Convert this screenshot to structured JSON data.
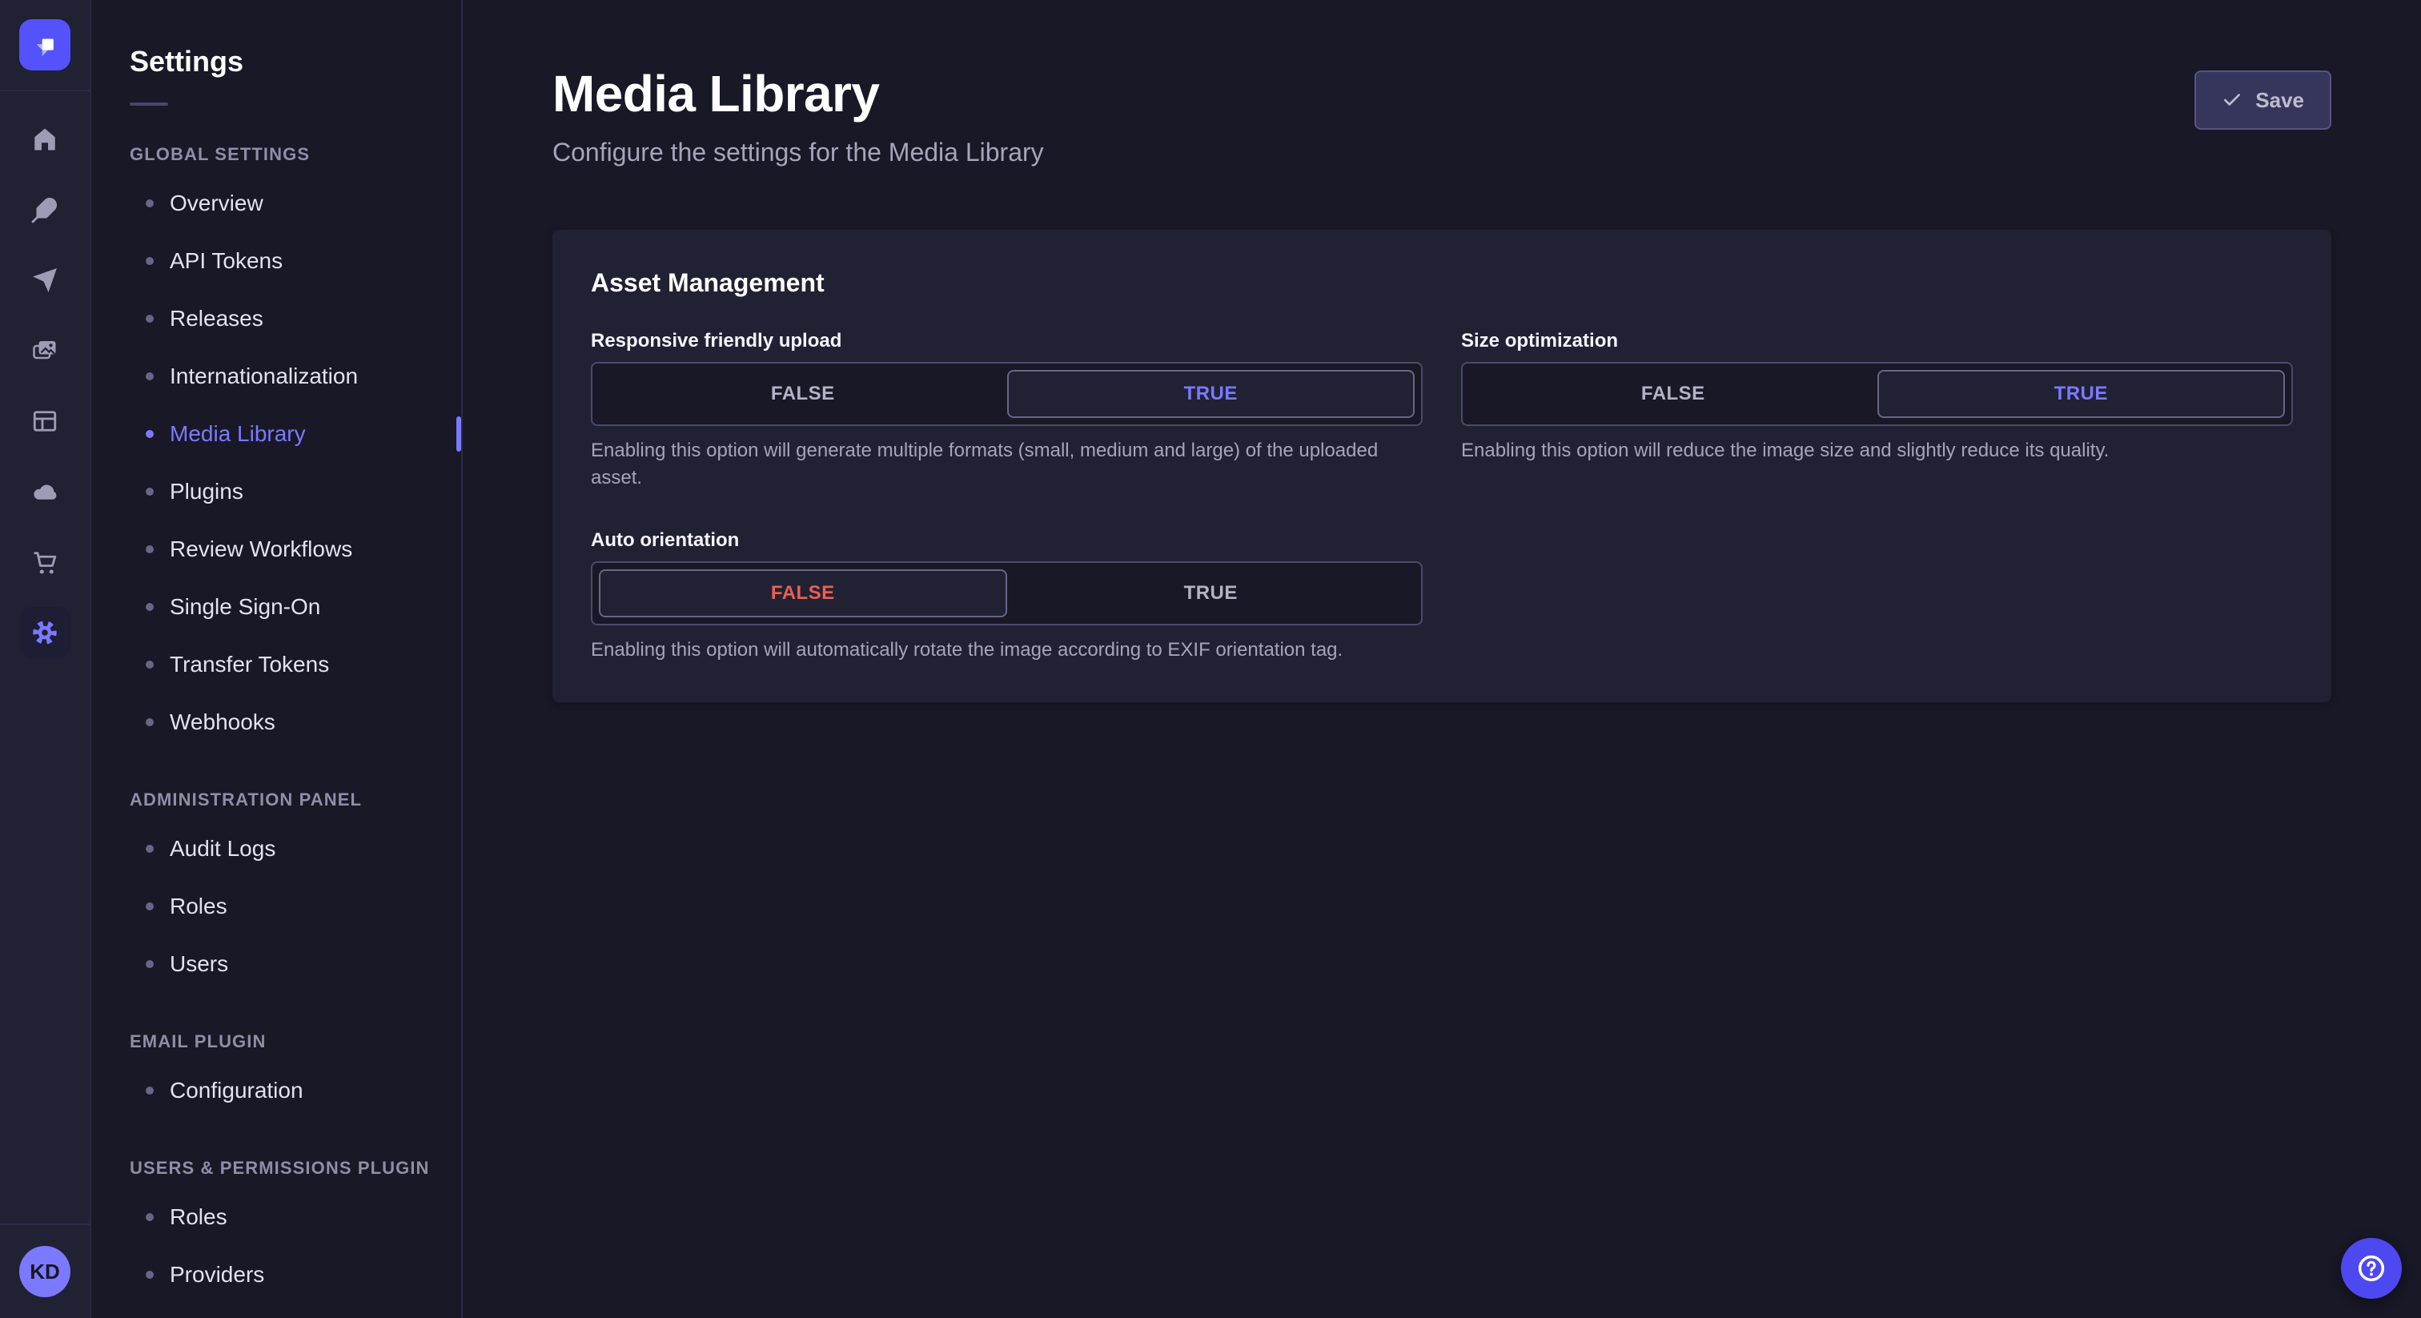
{
  "rail": {
    "avatar_initials": "KD",
    "icons": [
      {
        "name": "home-icon"
      },
      {
        "name": "feather-icon"
      },
      {
        "name": "paper-plane-icon"
      },
      {
        "name": "media-images-icon"
      },
      {
        "name": "layout-icon"
      },
      {
        "name": "cloud-icon"
      },
      {
        "name": "cart-icon"
      },
      {
        "name": "gear-icon",
        "active": true
      }
    ]
  },
  "subnav": {
    "title": "Settings",
    "sections": [
      {
        "label": "GLOBAL SETTINGS",
        "items": [
          {
            "label": "Overview"
          },
          {
            "label": "API Tokens"
          },
          {
            "label": "Releases"
          },
          {
            "label": "Internationalization"
          },
          {
            "label": "Media Library",
            "active": true
          },
          {
            "label": "Plugins"
          },
          {
            "label": "Review Workflows"
          },
          {
            "label": "Single Sign-On"
          },
          {
            "label": "Transfer Tokens"
          },
          {
            "label": "Webhooks"
          }
        ]
      },
      {
        "label": "ADMINISTRATION PANEL",
        "items": [
          {
            "label": "Audit Logs"
          },
          {
            "label": "Roles"
          },
          {
            "label": "Users"
          }
        ]
      },
      {
        "label": "EMAIL PLUGIN",
        "items": [
          {
            "label": "Configuration"
          }
        ]
      },
      {
        "label": "USERS & PERMISSIONS PLUGIN",
        "items": [
          {
            "label": "Roles"
          },
          {
            "label": "Providers"
          }
        ]
      }
    ]
  },
  "page": {
    "title": "Media Library",
    "subtitle": "Configure the settings for the Media Library",
    "save_label": "Save"
  },
  "card": {
    "title": "Asset Management",
    "fields": [
      {
        "label": "Responsive friendly upload",
        "options": [
          "FALSE",
          "TRUE"
        ],
        "value": "TRUE",
        "hint": "Enabling this option will generate multiple formats (small, medium and large) of the uploaded asset."
      },
      {
        "label": "Size optimization",
        "options": [
          "FALSE",
          "TRUE"
        ],
        "value": "TRUE",
        "hint": "Enabling this option will reduce the image size and slightly reduce its quality."
      },
      {
        "label": "Auto orientation",
        "options": [
          "FALSE",
          "TRUE"
        ],
        "value": "FALSE",
        "hint": "Enabling this option will automatically rotate the image according to EXIF orientation tag."
      }
    ]
  },
  "colors": {
    "accent": "#4945ff",
    "accent_light": "#7b79ff",
    "danger": "#ee5e52",
    "background": "#181826",
    "surface": "#212134",
    "border": "#4a4a6a"
  }
}
